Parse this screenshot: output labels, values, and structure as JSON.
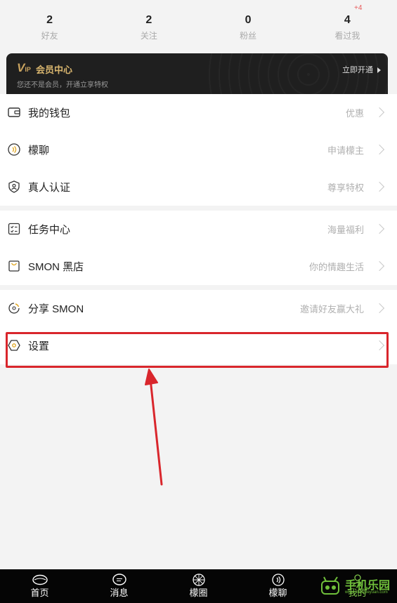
{
  "stats": [
    {
      "num": "2",
      "label": "好友"
    },
    {
      "num": "2",
      "label": "关注"
    },
    {
      "num": "0",
      "label": "粉丝"
    },
    {
      "num": "4",
      "label": "看过我",
      "badge": "+4"
    }
  ],
  "vip": {
    "logo": "V",
    "logo_small": "IP",
    "title": "会员中心",
    "subtitle": "您还不是会员，开通立享特权",
    "open_label": "立即开通"
  },
  "menu": {
    "group1": [
      {
        "label": "我的钱包",
        "hint": "优惠",
        "icon": "wallet-icon"
      },
      {
        "label": "檬聊",
        "hint": "申请檬主",
        "icon": "chat-wave-icon"
      },
      {
        "label": "真人认证",
        "hint": "尊享特权",
        "icon": "shield-user-icon"
      }
    ],
    "group2": [
      {
        "label": "任务中心",
        "hint": "海量福利",
        "icon": "task-list-icon"
      },
      {
        "label": "SMON 黑店",
        "hint": "你的情趣生活",
        "icon": "shop-bag-icon"
      }
    ],
    "group3": [
      {
        "label": "分享 SMON",
        "hint": "邀请好友赢大礼",
        "icon": "share-loop-icon"
      },
      {
        "label": "设置",
        "hint": "",
        "icon": "settings-hex-icon"
      }
    ]
  },
  "tabbar": [
    {
      "label": "首页",
      "icon": "lemon-home-icon"
    },
    {
      "label": "消息",
      "icon": "message-bubble-icon"
    },
    {
      "label": "檬圈",
      "icon": "circle-burst-icon"
    },
    {
      "label": "檬聊",
      "icon": "chat-wave-icon"
    },
    {
      "label": "我的",
      "icon": "profile-icon",
      "active": true
    }
  ],
  "watermark": {
    "text": "手机乐园",
    "url": "www.shoujileyuan.com"
  },
  "colors": {
    "highlight": "#d9262c",
    "vip_gold": "#d8b56e",
    "active_tab": "#7fc54a"
  }
}
